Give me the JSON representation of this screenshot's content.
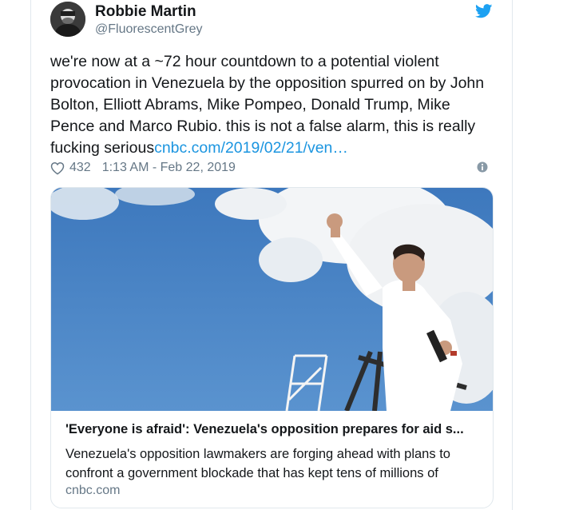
{
  "user": {
    "name": "Robbie Martin",
    "handle": "@FluorescentGrey"
  },
  "tweet": {
    "text": "we're now at a ~72 hour countdown to a potential violent provocation in Venezuela by the opposition spurred on by John Bolton, Elliott Abrams, Mike Pompeo, Donald Trump, Mike Pence and Marco Rubio. this is not a false alarm, this is really fucking serious",
    "link_text": "cnbc.com/2019/02/21/ven…",
    "likes": "432",
    "timestamp": "1:13 AM - Feb 22, 2019"
  },
  "link_card": {
    "title": "'Everyone is afraid': Venezuela's opposition prepares for aid s...",
    "description": "Venezuela's opposition lawmakers are forging ahead with plans to confront a government blockade that has kept tens of millions of",
    "domain": "cnbc.com"
  },
  "icons": {
    "bird": "twitter-bird-icon",
    "heart": "heart-icon",
    "info": "info-icon"
  },
  "colors": {
    "accent": "#1da1f2",
    "link": "#1b95e0",
    "secondary_text": "#657786",
    "sky": "#4a86c6"
  }
}
